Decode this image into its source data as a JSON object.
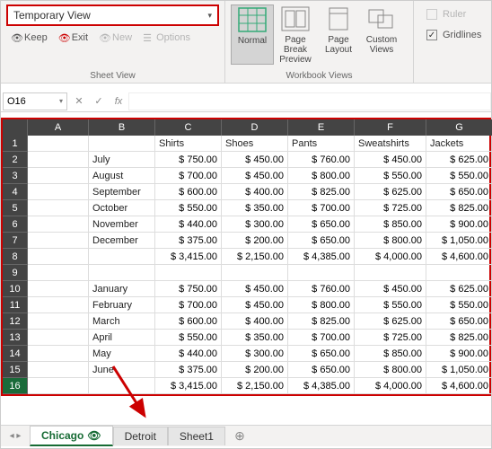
{
  "ribbon": {
    "sheet_view": {
      "dropdown": "Temporary View",
      "keep": "Keep",
      "exit": "Exit",
      "new": "New",
      "options": "Options",
      "group_label": "Sheet View"
    },
    "workbook_views": {
      "normal": "Normal",
      "page_break": "Page Break Preview",
      "page_layout": "Page Layout",
      "custom_views": "Custom Views",
      "group_label": "Workbook Views"
    },
    "show": {
      "ruler": "Ruler",
      "gridlines": "Gridlines"
    }
  },
  "namebox": "O16",
  "fx_label": "fx",
  "columns": [
    "A",
    "B",
    "C",
    "D",
    "E",
    "F",
    "G"
  ],
  "headers": {
    "B": "",
    "C": "Shirts",
    "D": "Shoes",
    "E": "Pants",
    "F": "Sweatshirts",
    "G": "Jackets"
  },
  "rows": [
    {
      "n": 1,
      "B": "",
      "C": "Shirts",
      "D": "Shoes",
      "E": "Pants",
      "F": "Sweatshirts",
      "G": "Jackets",
      "hdr": true
    },
    {
      "n": 2,
      "B": "July",
      "C": "$   750.00",
      "D": "$   450.00",
      "E": "$   760.00",
      "F": "$   450.00",
      "G": "$   625.00"
    },
    {
      "n": 3,
      "B": "August",
      "C": "$   700.00",
      "D": "$   450.00",
      "E": "$   800.00",
      "F": "$   550.00",
      "G": "$   550.00"
    },
    {
      "n": 4,
      "B": "September",
      "C": "$   600.00",
      "D": "$   400.00",
      "E": "$   825.00",
      "F": "$   625.00",
      "G": "$   650.00"
    },
    {
      "n": 5,
      "B": "October",
      "C": "$   550.00",
      "D": "$   350.00",
      "E": "$   700.00",
      "F": "$   725.00",
      "G": "$   825.00"
    },
    {
      "n": 6,
      "B": "November",
      "C": "$   440.00",
      "D": "$   300.00",
      "E": "$   650.00",
      "F": "$   850.00",
      "G": "$   900.00"
    },
    {
      "n": 7,
      "B": "December",
      "C": "$   375.00",
      "D": "$   200.00",
      "E": "$   650.00",
      "F": "$   800.00",
      "G": "$ 1,050.00"
    },
    {
      "n": 8,
      "B": "",
      "C": "$ 3,415.00",
      "D": "$ 2,150.00",
      "E": "$ 4,385.00",
      "F": "$  4,000.00",
      "G": "$ 4,600.00"
    },
    {
      "n": 9,
      "B": "",
      "C": "",
      "D": "",
      "E": "",
      "F": "",
      "G": ""
    },
    {
      "n": 10,
      "B": "January",
      "C": "$   750.00",
      "D": "$   450.00",
      "E": "$   760.00",
      "F": "$   450.00",
      "G": "$   625.00"
    },
    {
      "n": 11,
      "B": "February",
      "C": "$   700.00",
      "D": "$   450.00",
      "E": "$   800.00",
      "F": "$   550.00",
      "G": "$   550.00"
    },
    {
      "n": 12,
      "B": "March",
      "C": "$   600.00",
      "D": "$   400.00",
      "E": "$   825.00",
      "F": "$   625.00",
      "G": "$   650.00"
    },
    {
      "n": 13,
      "B": "April",
      "C": "$   550.00",
      "D": "$   350.00",
      "E": "$   700.00",
      "F": "$   725.00",
      "G": "$   825.00"
    },
    {
      "n": 14,
      "B": "May",
      "C": "$   440.00",
      "D": "$   300.00",
      "E": "$   650.00",
      "F": "$   850.00",
      "G": "$   900.00"
    },
    {
      "n": 15,
      "B": "June",
      "C": "$   375.00",
      "D": "$   200.00",
      "E": "$   650.00",
      "F": "$   800.00",
      "G": "$ 1,050.00"
    },
    {
      "n": 16,
      "B": "",
      "C": "$ 3,415.00",
      "D": "$ 2,150.00",
      "E": "$ 4,385.00",
      "F": "$  4,000.00",
      "G": "$ 4,600.00",
      "sel": true
    }
  ],
  "tabs": {
    "chicago": "Chicago",
    "detroit": "Detroit",
    "sheet1": "Sheet1"
  }
}
